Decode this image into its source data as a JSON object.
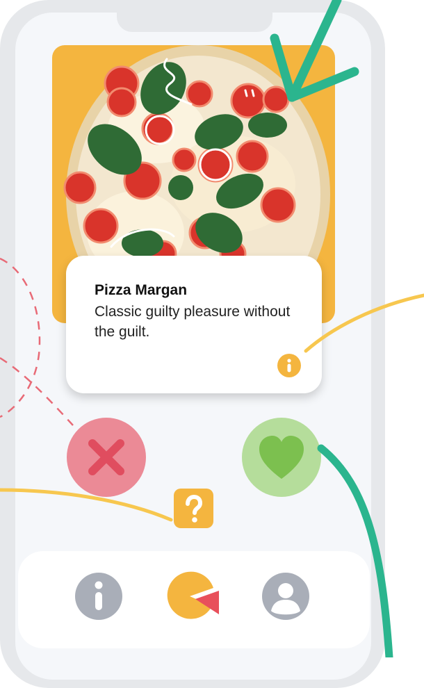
{
  "card": {
    "title": "Pizza Margan",
    "description": "Classic guilty pleasure without the guilt."
  },
  "icons": {
    "info": "info-icon",
    "reject": "close-icon",
    "like": "heart-icon",
    "help": "question-icon",
    "nav_info": "info-icon",
    "nav_stats": "pie-chart-icon",
    "nav_profile": "user-icon"
  },
  "colors": {
    "accent_yellow": "#f4b53f",
    "reject_red": "#e04d5f",
    "reject_bg": "#eb8a96",
    "like_green": "#7cc04f",
    "like_bg": "#b5dd9b",
    "annotation_teal": "#2bb58e",
    "annotation_yellow": "#f7c74f",
    "dashed_red": "#e86a76"
  }
}
